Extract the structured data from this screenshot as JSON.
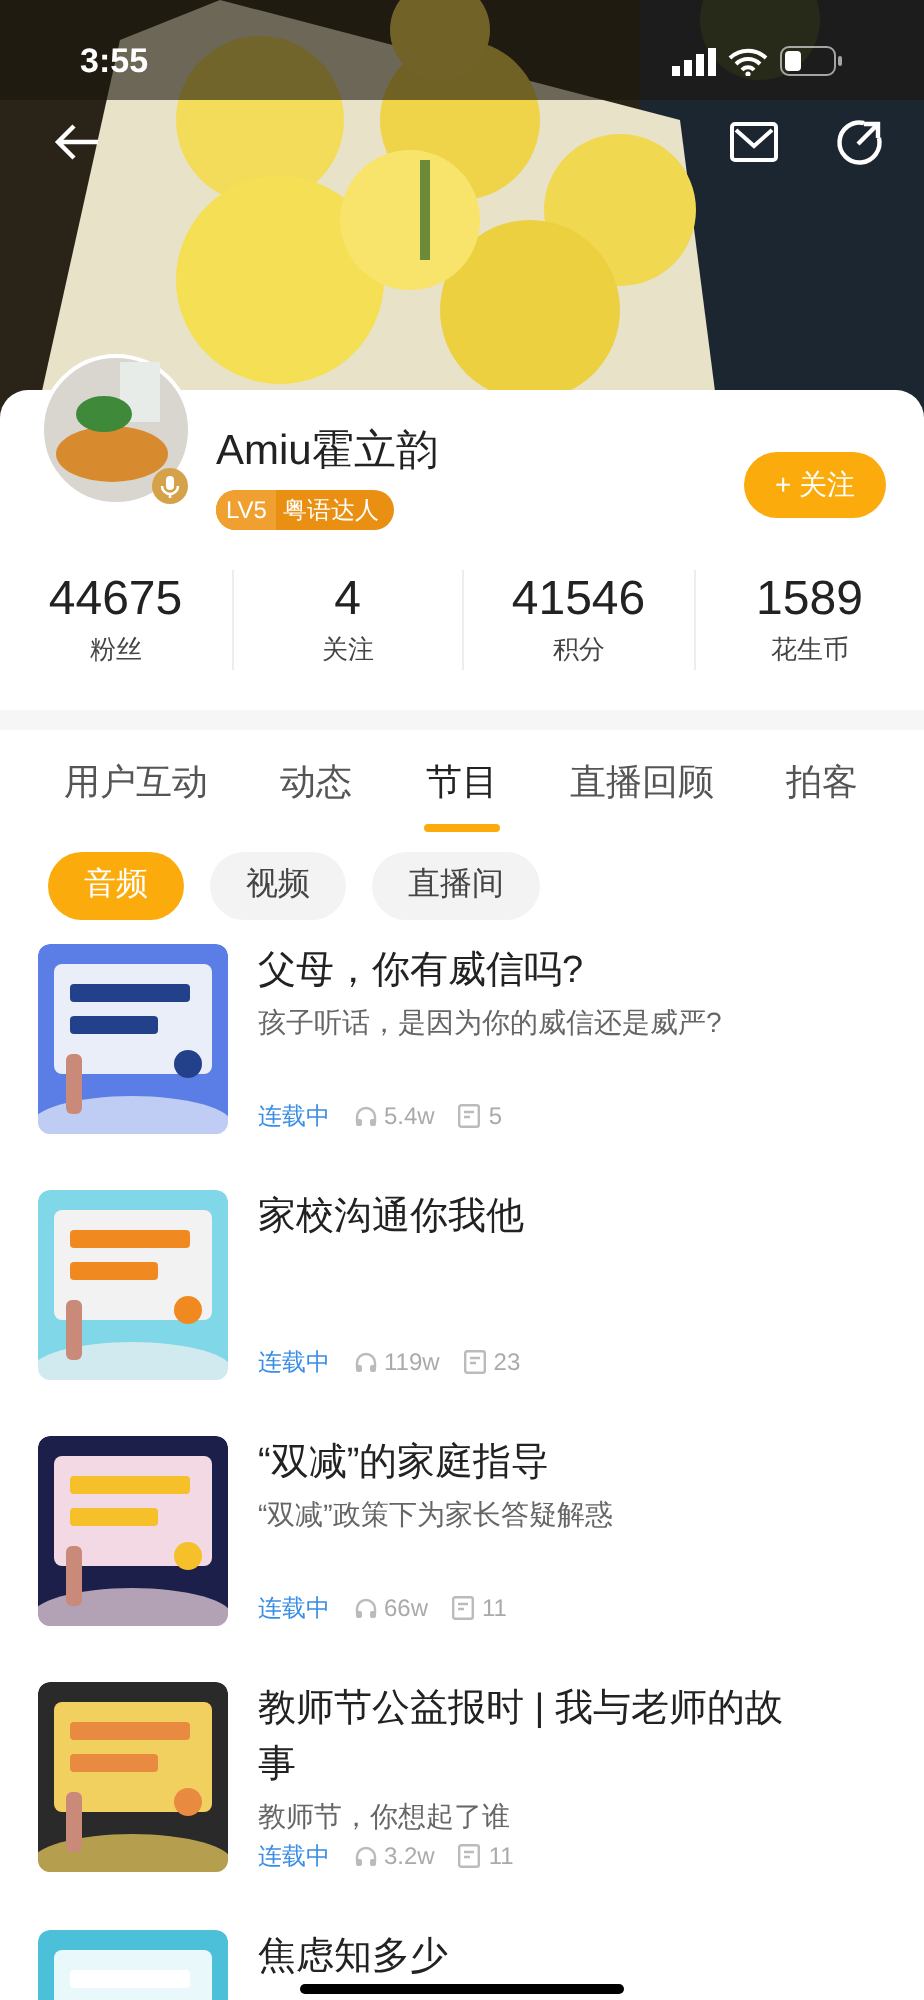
{
  "status_bar": {
    "time": "3:55"
  },
  "profile": {
    "name": "Amiu霍立韵",
    "level": "LV5",
    "title_badge": "粤语达人",
    "follow_button": "+ 关注"
  },
  "stats": [
    {
      "value": "44675",
      "label": "粉丝"
    },
    {
      "value": "4",
      "label": "关注"
    },
    {
      "value": "41546",
      "label": "积分"
    },
    {
      "value": "1589",
      "label": "花生币"
    }
  ],
  "tabs": [
    {
      "label": "用户互动",
      "selected": false
    },
    {
      "label": "动态",
      "selected": false
    },
    {
      "label": "节目",
      "selected": true
    },
    {
      "label": "直播回顾",
      "selected": false
    },
    {
      "label": "拍客",
      "selected": false
    }
  ],
  "filters": [
    {
      "label": "音频",
      "selected": true
    },
    {
      "label": "视频",
      "selected": false
    },
    {
      "label": "直播间",
      "selected": false
    }
  ],
  "programs": [
    {
      "title": "父母，你有威信吗?",
      "subtitle": "孩子听话，是因为你的威信还是威严?",
      "status": "连载中",
      "plays": "5.4w",
      "episodes": "5"
    },
    {
      "title": "家校沟通你我他",
      "status": "连载中",
      "plays": "119w",
      "episodes": "23"
    },
    {
      "title": "“双减”的家庭指导",
      "subtitle": "“双减”政策下为家长答疑解惑",
      "status": "连载中",
      "plays": "66w",
      "episodes": "11"
    },
    {
      "title": "教师节公益报时 | 我与老师的故事",
      "subtitle": "教师节，你想起了谁",
      "status": "连载中",
      "plays": "3.2w",
      "episodes": "11"
    },
    {
      "title": "焦虑知多少"
    }
  ]
}
